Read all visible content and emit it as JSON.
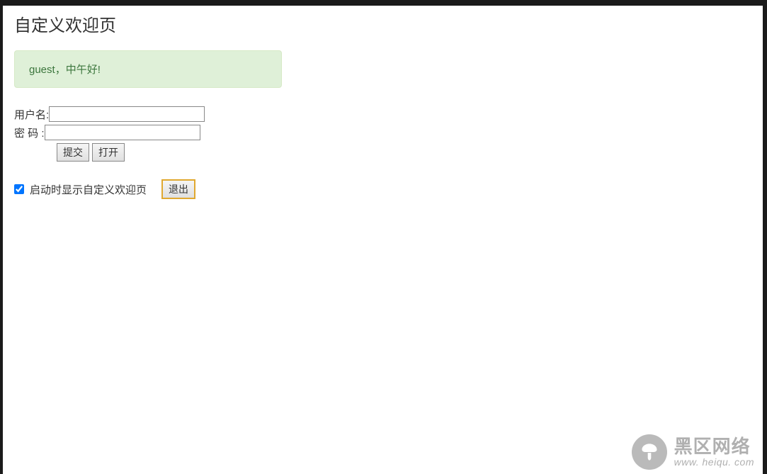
{
  "page": {
    "title": "自定义欢迎页"
  },
  "alert": {
    "message": "guest，中午好!"
  },
  "form": {
    "username_label": "用户名:",
    "username_value": "",
    "password_label": "密  码 :",
    "password_value": "",
    "submit_label": "提交",
    "open_label": "打开"
  },
  "settings": {
    "checkbox_checked": true,
    "checkbox_label": "启动时显示自定义欢迎页",
    "logout_label": "退出"
  },
  "watermark": {
    "name_cn": "黑区网络",
    "name_en": "www. heiqu. com"
  }
}
